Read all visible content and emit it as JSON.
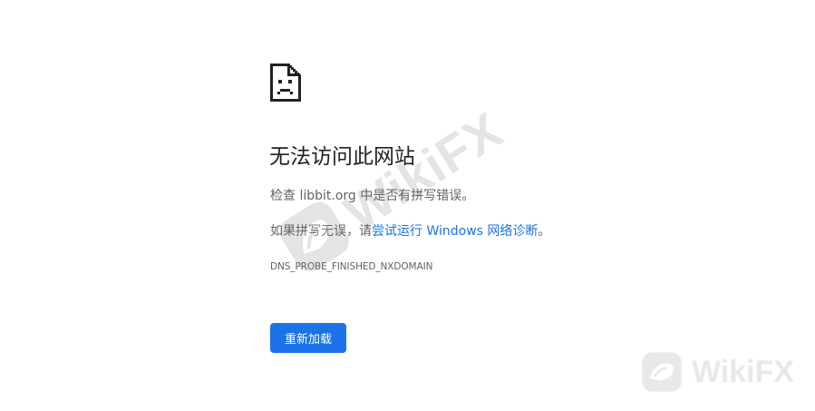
{
  "error": {
    "icon": "sad-page-icon",
    "title": "无法访问此网站",
    "check_prefix": "检查 ",
    "check_host": "libbit.org",
    "check_suffix": " 中是否有拼写错误。",
    "suggest_prefix": "如果拼写无误，请",
    "suggest_link": "尝试运行 Windows 网络诊断",
    "suggest_suffix": "。",
    "code": "DNS_PROBE_FINISHED_NXDOMAIN"
  },
  "actions": {
    "reload_label": "重新加载"
  },
  "watermark": {
    "center_text": "WikiFX",
    "corner_text": "WikiFX"
  },
  "colors": {
    "accent": "#1a73e8",
    "text_primary": "#202124",
    "text_secondary": "#5f6368"
  }
}
